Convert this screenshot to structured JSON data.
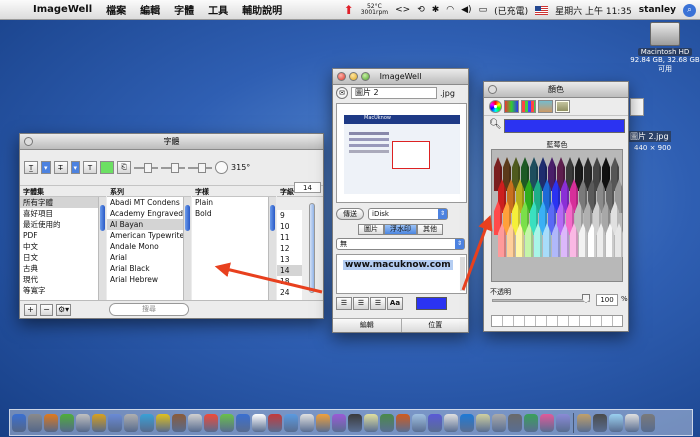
{
  "menubar": {
    "apple_glyph": "",
    "app": "ImageWell",
    "items": [
      "檔案",
      "編輯",
      "字體",
      "工具",
      "輔助說明"
    ],
    "temperature": "52°C",
    "rpm": "3001rpm",
    "battery": "(已充電)",
    "clock": "星期六 上午 11:35",
    "user": "stanley"
  },
  "desktop": {
    "disk_name": "Macintosh HD",
    "disk_info": "92.84 GB, 32.68 GB 可用",
    "file_name": "圖片 2.jpg",
    "file_dims": "440 × 900"
  },
  "font_panel": {
    "title": "字體",
    "angle": "315°",
    "headers": {
      "collections": "字體集",
      "family": "系列",
      "typeface": "字樣",
      "size": "字級"
    },
    "collections": [
      "所有字體",
      "喜好項目",
      "最近使用的",
      "PDF",
      "中文",
      "日文",
      "古典",
      "現代",
      "等寬字"
    ],
    "families": [
      "Abadi MT Condens",
      "Academy Engraved",
      "Al Bayan",
      "American Typewrite",
      "Andale Mono",
      "Arial",
      "Arial Black",
      "Arial Hebrew"
    ],
    "typefaces": [
      "Plain",
      "Bold"
    ],
    "size_value": "14",
    "sizes": [
      "9",
      "10",
      "11",
      "12",
      "13",
      "14",
      "18",
      "24"
    ],
    "add_label": "+",
    "remove_label": "−",
    "action_label": "⚙▾",
    "search_placeholder": "搜尋"
  },
  "imagewell": {
    "title": "ImageWell",
    "filename": "圖片 2",
    "extension": ".jpg",
    "send_label": "傳送",
    "destination": "iDisk",
    "tabs": [
      "圖片",
      "浮水印",
      "其他"
    ],
    "watermark_mode": "無",
    "watermark_text": "www.macuknow.com",
    "text_style_label": "Aa",
    "swatch_color": "#2b33f2",
    "bottom_buttons": [
      "編輯",
      "位置"
    ],
    "preview_site": "MacUknow"
  },
  "color_panel": {
    "title": "顏色",
    "selected_color": "#2b33f2",
    "color_name": "藍莓色",
    "opacity_label": "不透明",
    "opacity_value": "100",
    "percent_sign": "%"
  },
  "crayon_colors": {
    "row1": [
      "#7a1f1f",
      "#5b3a1a",
      "#4f5a1e",
      "#1e5a24",
      "#1e4e5e",
      "#1e2d6e",
      "#4a1e6a",
      "#5e1e4e",
      "#3a3a3a",
      "#1a1a1a",
      "#2a2a2a",
      "#444444",
      "#101010",
      "#555555"
    ],
    "row2": [
      "#cc1f1f",
      "#c8701e",
      "#b8b01e",
      "#2fae1e",
      "#1eae8a",
      "#1e6ad6",
      "#2b33f2",
      "#8a2fd6",
      "#d62f9a",
      "#7a7a7a",
      "#5a5a5a",
      "#8a8a8a",
      "#6a6a6a",
      "#9a9a9a"
    ],
    "row3": [
      "#ff4a4a",
      "#ffa03a",
      "#f5f03a",
      "#7ae04a",
      "#3ae0c0",
      "#3ab0f5",
      "#5a6af5",
      "#b56af5",
      "#f56ac8",
      "#c0c0c0",
      "#b0b0b0",
      "#d0d0d0",
      "#a8a8a8",
      "#e0e0e0"
    ],
    "row4": [
      "#ff9a9a",
      "#ffcf9a",
      "#fff7a8",
      "#c4f5a8",
      "#a8f5e8",
      "#a8dcfa",
      "#b0b8fa",
      "#dcb8fa",
      "#fab8e4",
      "#f2f2f2",
      "#ffffff",
      "#ececec",
      "#f8f8f8",
      "#e6e6e6"
    ]
  },
  "dock_colors": [
    "#3a6fd1",
    "#8a8a8a",
    "#e07a1e",
    "#4fae3a",
    "#c0c0c0",
    "#d8a01e",
    "#6a8ad6",
    "#b0b0b0",
    "#3aa0d6",
    "#e0c01e",
    "#8a5a3a",
    "#d0d0d0",
    "#f04a3a",
    "#6ac04a",
    "#3a6fd1",
    "#ffffff",
    "#c43a3a",
    "#5a9ae0",
    "#e0e0e0",
    "#f0a03a",
    "#9a5ad6",
    "#3a3a3a",
    "#e0e0a0",
    "#4a8a4a",
    "#d05a1e",
    "#a0c0e0",
    "#5a5ad6",
    "#e0e0e0",
    "#1e7ad6",
    "#d0d0a0",
    "#aaaaaa",
    "#6a6a6a",
    "#3aa05a",
    "#e05a9a",
    "#8a8ad6",
    "#c0a06a",
    "#4a4a4a",
    "#9ad0f0",
    "#e0e0e0",
    "#7a7a7a"
  ]
}
